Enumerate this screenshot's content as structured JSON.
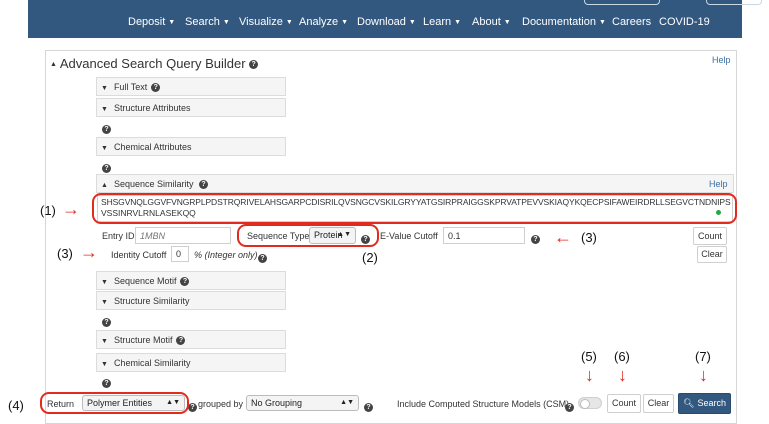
{
  "nav": {
    "items": [
      {
        "label": "Deposit",
        "caret": true
      },
      {
        "label": "Search",
        "caret": true
      },
      {
        "label": "Visualize",
        "caret": true
      },
      {
        "label": "Analyze",
        "caret": true
      },
      {
        "label": "Download",
        "caret": true
      },
      {
        "label": "Learn",
        "caret": true
      },
      {
        "label": "About",
        "caret": true
      },
      {
        "label": "Documentation",
        "caret": true
      },
      {
        "label": "Careers",
        "caret": false
      },
      {
        "label": "COVID-19",
        "caret": false
      }
    ]
  },
  "builder": {
    "title": "Advanced Search Query Builder",
    "help": "Help",
    "sections": {
      "full_text": "Full Text",
      "structure_attributes": "Structure Attributes",
      "chemical_attributes": "Chemical Attributes",
      "sequence_similarity": "Sequence Similarity",
      "sequence_motif": "Sequence Motif",
      "structure_similarity": "Structure Similarity",
      "structure_motif": "Structure Motif",
      "chemical_similarity": "Chemical Similarity"
    },
    "seq": {
      "help": "Help",
      "sequence_line1": "SHSGVNQLGGVFVNGRPLPDSTRQRIVELAHSGARPCDISRILQVSNGCVSKILGRYYATGSIRPRAIGGSKPRVATPEVVSKIAQYKQECPSIFAWEIRDRLLSEGVCTNDNIPS",
      "sequence_line2": "VSSINRVLRNLASEKQQ",
      "entry_id_label": "Entry ID",
      "entry_id_placeholder": "1MBN",
      "sequence_type_label": "Sequence Type",
      "sequence_type_value": "Protein",
      "evalue_label": "E-Value Cutoff",
      "evalue_value": "0.1",
      "identity_label": "Identity Cutoff",
      "identity_value": "0",
      "identity_unit": "% (Integer only)",
      "count": "Count",
      "clear": "Clear"
    }
  },
  "footer": {
    "return_label": "Return",
    "return_value": "Polymer Entities",
    "grouped_by": "grouped by",
    "grouping_value": "No Grouping",
    "csm_label": "Include Computed Structure Models (CSM)",
    "count": "Count",
    "clear": "Clear",
    "search": "Search"
  },
  "annotations": [
    "(1)",
    "(2)",
    "(3)",
    "(3)",
    "(4)",
    "(5)",
    "(6)",
    "(7)"
  ],
  "colors": {
    "nav": "#325880",
    "annotation_red": "#e02b1f",
    "search_button": "#325880",
    "toggle_dot": "#27a844"
  }
}
